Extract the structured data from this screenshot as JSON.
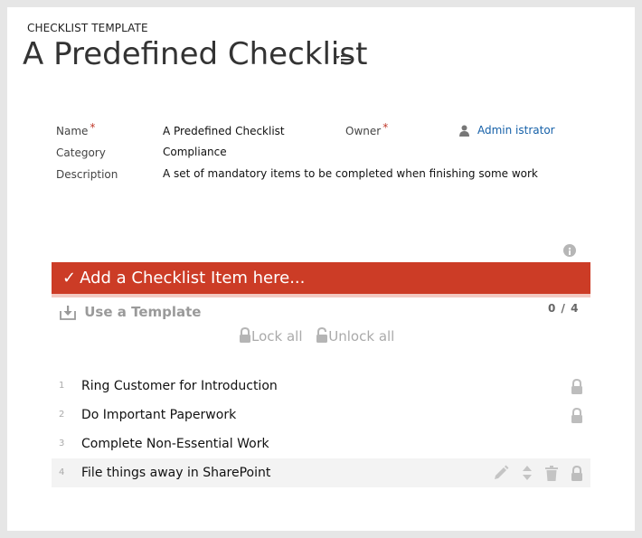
{
  "header": {
    "entity_label": "CHECKLIST TEMPLATE",
    "title": "A Predefined Checklist"
  },
  "fields": {
    "name_label": "Name",
    "name_value": "A Predefined Checklist",
    "owner_label": "Owner",
    "owner_value": "Admin istrator",
    "category_label": "Category",
    "category_value": "Compliance",
    "description_label": "Description",
    "description_value": "A set of mandatory items to be completed when finishing some work",
    "required_marker": "*"
  },
  "checklist": {
    "add_check": "✓",
    "add_placeholder": "Add a Checklist Item here...",
    "use_template_label": "Use a Template",
    "counter": "0 / 4",
    "lock_all_label": "Lock all",
    "unlock_all_label": "Unlock all",
    "items": [
      {
        "num": "1",
        "text": "Ring Customer for Introduction",
        "locked": true
      },
      {
        "num": "2",
        "text": "Do Important Paperwork",
        "locked": true
      },
      {
        "num": "3",
        "text": "Complete Non-Essential Work",
        "locked": false
      },
      {
        "num": "4",
        "text": "File things away in SharePoint",
        "locked": true
      }
    ]
  },
  "colors": {
    "accent": "#cc3c26",
    "link": "#1560a8",
    "required": "#c0392b"
  },
  "icons": {
    "title_menu": "list-menu-icon",
    "owner": "user-icon",
    "info": "info-icon",
    "use_template": "download-icon",
    "lock": "lock-icon",
    "unlock": "unlock-icon",
    "edit": "pencil-icon",
    "move": "updown-arrows-icon",
    "delete": "trash-icon"
  }
}
